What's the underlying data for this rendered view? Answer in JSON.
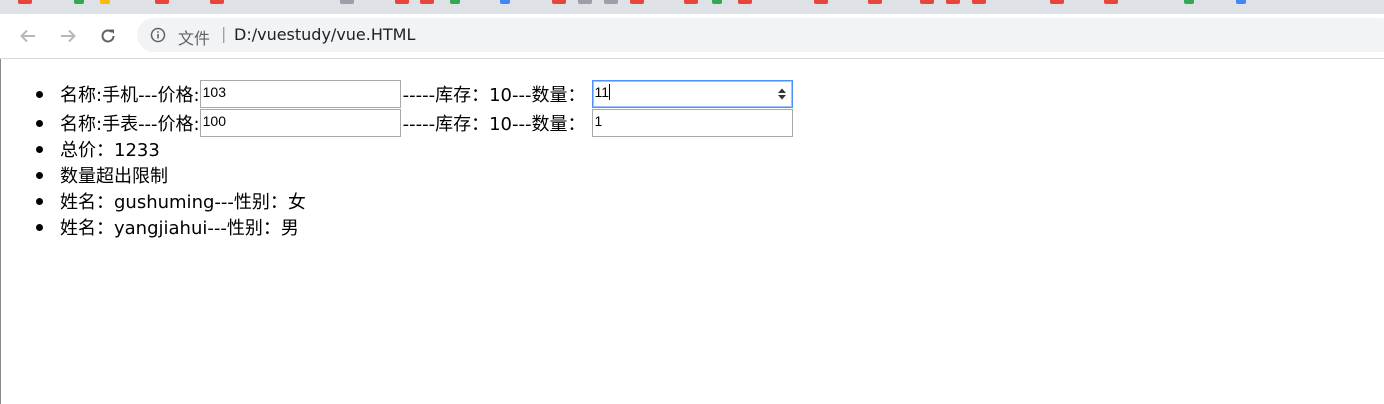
{
  "browser": {
    "scheme_label": "文件",
    "separator": "|",
    "url": "D:/vuestudy/vue.HTML"
  },
  "products": [
    {
      "name_prefix": "名称:手机---价格:",
      "price": "103",
      "stock_text": "-----库存：10---数量：",
      "quantity": "11"
    },
    {
      "name_prefix": "名称:手表---价格:",
      "price": "100",
      "stock_text": "-----库存：10---数量：",
      "quantity": "1"
    }
  ],
  "total": "总价：1233",
  "warning": "数量超出限制",
  "people": [
    "姓名：gushuming---性别：女",
    "姓名：yangjiahui---性别：男"
  ],
  "colors": {
    "accent_focus": "#4d90fe",
    "bookmark_red": "#e8453c",
    "bookmark_green": "#34a853"
  }
}
